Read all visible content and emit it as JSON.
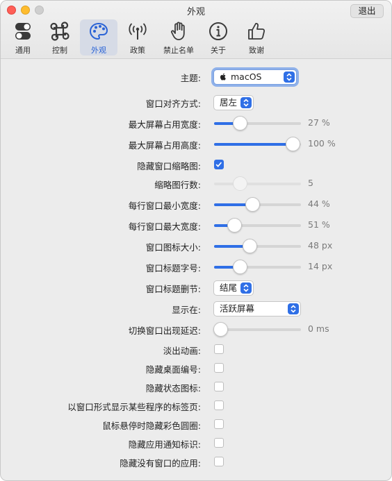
{
  "window": {
    "title": "外观",
    "quit_label": "退出"
  },
  "tabs": [
    {
      "label": "通用",
      "icon": "toggles-icon"
    },
    {
      "label": "控制",
      "icon": "command-key-icon"
    },
    {
      "label": "外观",
      "icon": "palette-icon",
      "active": true
    },
    {
      "label": "政策",
      "icon": "antenna-icon"
    },
    {
      "label": "禁止名单",
      "icon": "hand-stop-icon"
    },
    {
      "label": "关于",
      "icon": "info-icon"
    },
    {
      "label": "致谢",
      "icon": "thumbs-up-icon"
    }
  ],
  "settings": {
    "theme": {
      "label": "主题:",
      "value": "macOS"
    },
    "align": {
      "label": "窗口对齐方式:",
      "value": "居左"
    },
    "max_width": {
      "label": "最大屏幕占用宽度:",
      "value_text": "27 %",
      "fraction": 0.27
    },
    "max_height": {
      "label": "最大屏幕占用高度:",
      "value_text": "100 %",
      "fraction": 1.0
    },
    "hide_thumbnails": {
      "label": "隐藏窗口缩略图:",
      "checked": true
    },
    "thumb_rows": {
      "label": "缩略图行数:",
      "value_text": "5",
      "fraction": 0.27
    },
    "min_width": {
      "label": "每行窗口最小宽度:",
      "value_text": "44 %",
      "fraction": 0.44
    },
    "max_row_width": {
      "label": "每行窗口最大宽度:",
      "value_text": "51 %",
      "fraction": 0.19
    },
    "icon_size": {
      "label": "窗口图标大小:",
      "value_text": "48 px",
      "fraction": 0.4
    },
    "title_font": {
      "label": "窗口标题字号:",
      "value_text": "14 px",
      "fraction": 0.27
    },
    "title_truncation": {
      "label": "窗口标题删节:",
      "value": "结尾"
    },
    "show_on": {
      "label": "显示在:",
      "value": "活跃屏幕"
    },
    "appear_delay": {
      "label": "切换窗口出现延迟:",
      "value_text": "0 ms",
      "fraction": 0.0
    },
    "fade_out": {
      "label": "淡出动画:",
      "checked": false
    },
    "hide_space_number": {
      "label": "隐藏桌面编号:",
      "checked": false
    },
    "hide_status_icons": {
      "label": "隐藏状态图标:",
      "checked": false
    },
    "show_tabs_as_windows": {
      "label": "以窗口形式显示某些程序的标签页:",
      "checked": false
    },
    "hide_colored_circles": {
      "label": "鼠标悬停时隐藏彩色圆圈:",
      "checked": false
    },
    "hide_app_badges": {
      "label": "隐藏应用通知标识:",
      "checked": false
    },
    "hide_windowless_apps": {
      "label": "隐藏没有窗口的应用:",
      "checked": false
    }
  },
  "colors": {
    "accent": "#2f6fe6"
  }
}
